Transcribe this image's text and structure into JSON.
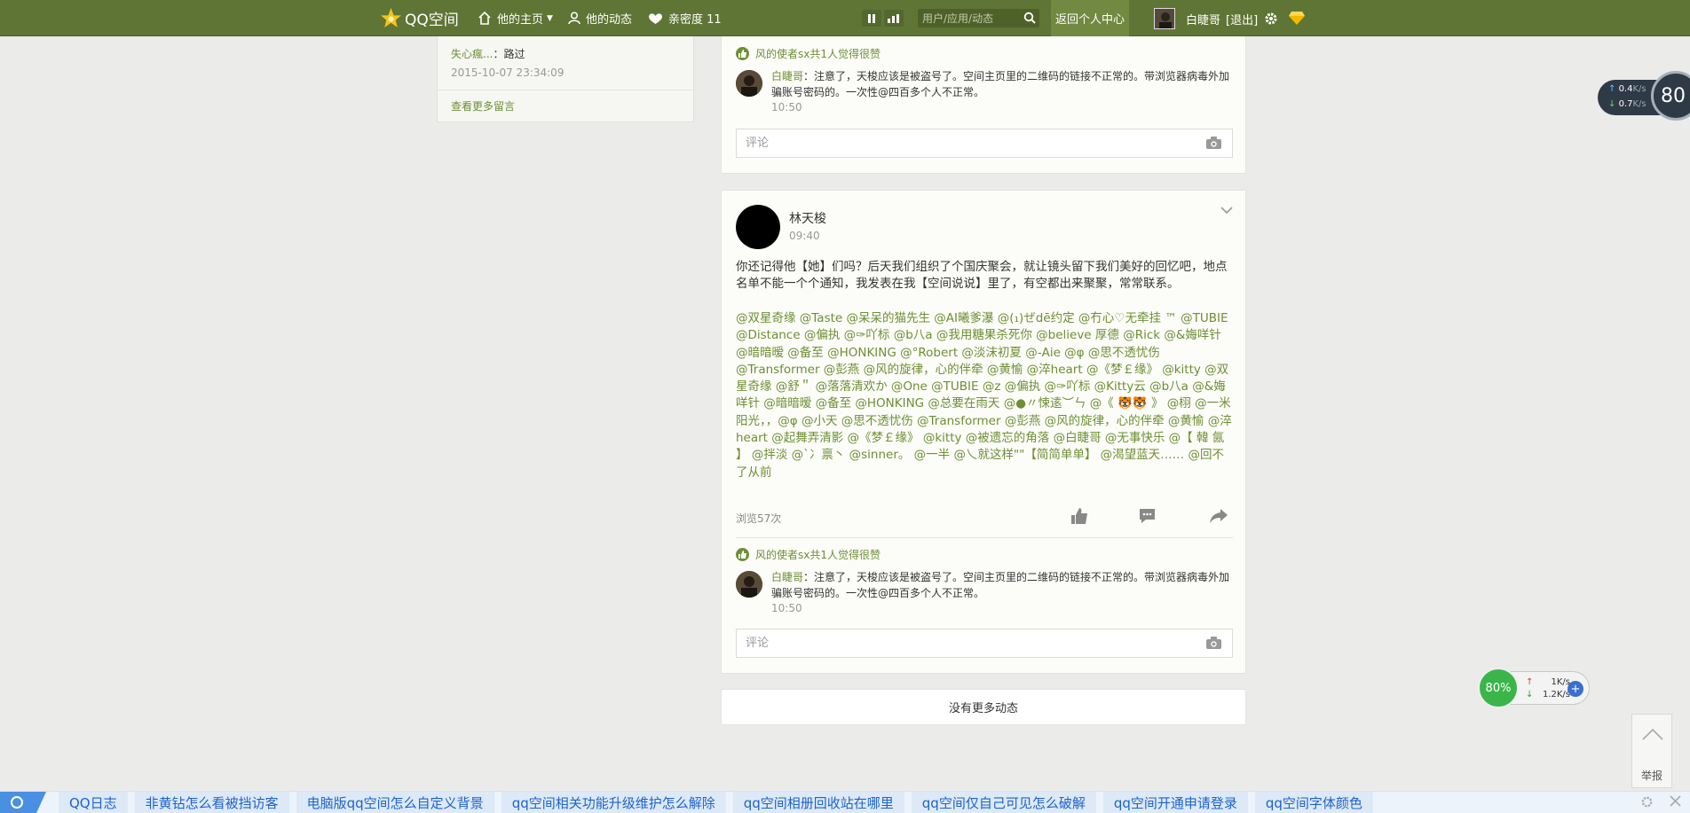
{
  "topbar": {
    "brand": "QQ空间",
    "home": "他的主页",
    "feed": "他的动态",
    "intimacy": "亲密度 11",
    "search_placeholder": "用户/应用/动态",
    "return_center": "返回个人中心",
    "user_name": "白睫哥",
    "logout": "[退出]"
  },
  "left_box": {
    "name": "失心瘋...",
    "separator": "：",
    "message": "路过",
    "time": "2015-10-07 23:34:09",
    "more": "查看更多留言"
  },
  "card1": {
    "like_text": "风的使者sx共1人觉得很赞",
    "comment": {
      "author": "白睫哥",
      "text": "：注意了，天梭应该是被盗号了。空间主页里的二维码的链接不正常的。带浏览器病毒外加骗账号密码的。一次性@四百多个人不正常。",
      "time": "10:50"
    },
    "comment_placeholder": "评论"
  },
  "card2": {
    "poster_name": "林天梭",
    "poster_time": "09:40",
    "body": "你还记得他【她】们吗？后天我们组织了个国庆聚会，就让镜头留下我们美好的回忆吧，地点名单不能一个个通知，我发表在我【空间说说】里了，有空都出来聚聚，常常联系。",
    "mentions": "@双星奇缘 @Taste @呆呆的猫先生 @AI曦爹瀑 @(₁)ぜdē约定 @冇心♡无牵挂 ™ @TUBIE @Distance @偏执 @✑吖标 @b八a @我用糖果杀死你 @believe 厚德 @Rick @&娒咩针 @暗暗暧 @备至 @HONKING @°Robert @淡沫初夏 @-Aie @φ @思不透忧伤 @Transformer @彭燕 @风的旋律，心的伴牵 @黄愉 @淬heart @《梦￡缘》 @kitty @双星奇缘 @舒＂ @落落清欢か @One @TUBIE @z @偏执 @✑吖标 @Kitty云 @b八a @&娒咩针 @暗暗暧 @备至 @HONKING @总要在雨天 @●〃悚逺︶ㄣ @《 🐯🐯 》 @栩 @一米阳光，，@φ @小天 @思不透忧伤 @Transformer @彭燕 @风的旋律，心的伴牵 @黄愉 @淬heart @起舞弄清影 @《梦￡缘》 @kitty @被遗忘的角落 @白睫哥 @无事快乐 @【 韓 氤 】 @拌淡 @`冫禀丶 @sinner。 @一半 @乀就这样\"\"【简简单单】 @渴望蓝天…… @回不了从前",
    "views": "浏览57次",
    "like_text": "风的使者sx共1人觉得很赞",
    "comment": {
      "author": "白睫哥",
      "text": "：注意了，天梭应该是被盗号了。空间主页里的二维码的链接不正常的。带浏览器病毒外加骗账号密码的。一次性@四百多个人不正常。",
      "time": "10:50"
    },
    "comment_placeholder": "评论"
  },
  "no_more": "没有更多动态",
  "speed_tr": {
    "up": "0.4",
    "down": "0.7",
    "unit": "K/s",
    "percent": "80"
  },
  "speed_br": {
    "percent": "80%",
    "up": "1K/s",
    "down": "1.2K/s"
  },
  "side_tools": {
    "report": "举报"
  },
  "bottom_links": [
    "QQ日志",
    "非黄钻怎么看被挡访客",
    "电脑版qq空间怎么自定义背景",
    "qq空间相关功能升级维护怎么解除",
    "qq空间相册回收站在哪里",
    "qq空间仅自己可见怎么破解",
    "qq空间开通申请登录",
    "qq空间字体颜色"
  ],
  "colors": {
    "nav": "#5f7535",
    "accent": "#6d8f35",
    "background": "#ebebea"
  }
}
